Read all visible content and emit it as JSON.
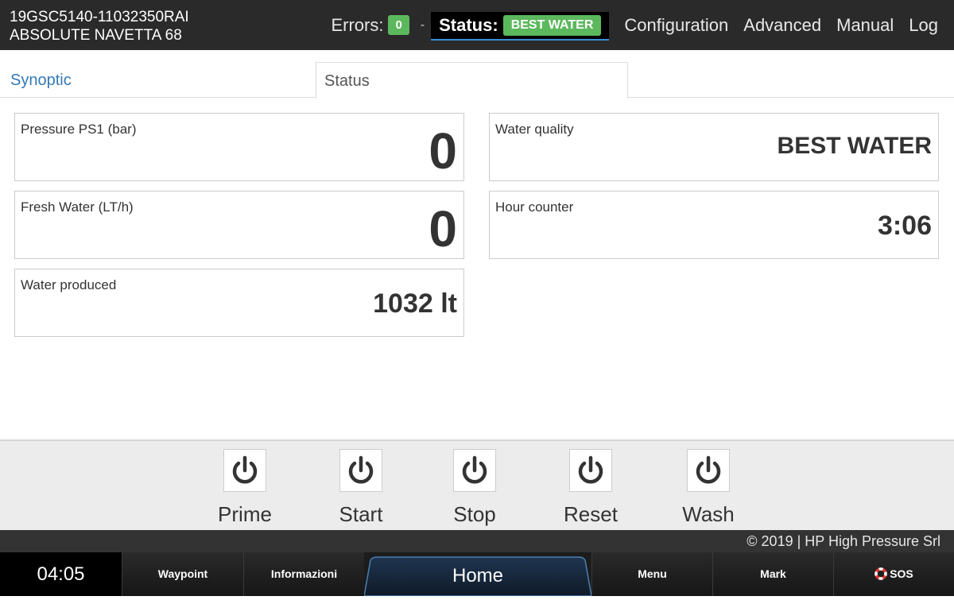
{
  "header": {
    "device_id": "19GSC5140-11032350RAI",
    "device_model": "ABSOLUTE NAVETTA 68",
    "errors_label": "Errors:",
    "errors_count": "0",
    "separator": "-",
    "status_label": "Status:",
    "status_value": "BEST WATER",
    "nav": [
      "Configuration",
      "Advanced",
      "Manual",
      "Log"
    ]
  },
  "tabs": {
    "synoptic": "Synoptic",
    "status": "Status"
  },
  "cards": {
    "pressure": {
      "label": "Pressure PS1 (bar)",
      "value": "0"
    },
    "fresh_water": {
      "label": "Fresh Water (LT/h)",
      "value": "0"
    },
    "water_produced": {
      "label": "Water produced",
      "value": "1032 lt"
    },
    "water_quality": {
      "label": "Water quality",
      "value": "BEST WATER"
    },
    "hour_counter": {
      "label": "Hour counter",
      "value": "3:06"
    }
  },
  "actions": [
    "Prime",
    "Start",
    "Stop",
    "Reset",
    "Wash"
  ],
  "footer": {
    "copyright": "© 2019  |  HP High Pressure Srl"
  },
  "bottom_nav": {
    "clock": "04:05",
    "waypoint": "Waypoint",
    "informazioni": "Informazioni",
    "home": "Home",
    "menu": "Menu",
    "mark": "Mark",
    "sos": "SOS"
  },
  "colors": {
    "ok_badge": "#5cb85c",
    "link_blue": "#337ab7",
    "header_bg": "#2a2a2a"
  },
  "icons": {
    "action_buttons": "power-icon",
    "sos": "lifebuoy-icon"
  }
}
